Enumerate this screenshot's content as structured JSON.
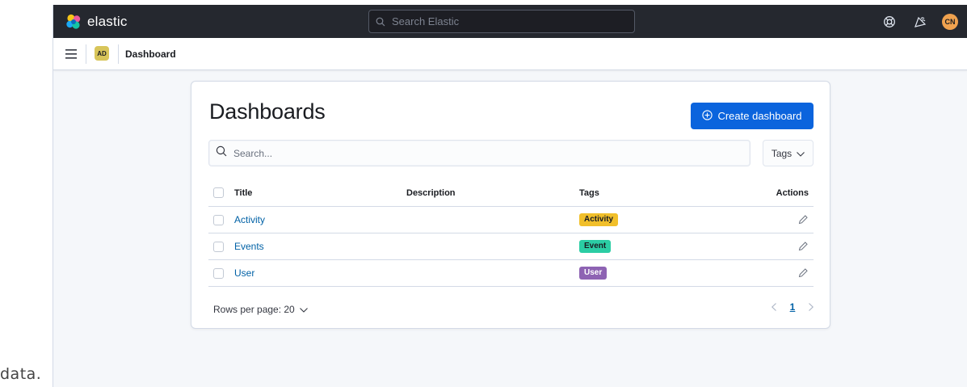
{
  "caption_fragment": "data.",
  "topbar": {
    "brand_name": "elastic",
    "search_placeholder": "Search Elastic",
    "icons": [
      "help-icon",
      "newsfeed-icon"
    ],
    "user_initials": "CN"
  },
  "header": {
    "space_initials": "AD",
    "breadcrumb": "Dashboard"
  },
  "main": {
    "title": "Dashboards",
    "create_button": "Create dashboard",
    "search_placeholder": "Search...",
    "tags_filter": "Tags",
    "columns": {
      "title": "Title",
      "description": "Description",
      "tags": "Tags",
      "actions": "Actions"
    },
    "rows": [
      {
        "title": "Activity",
        "description": "",
        "tag": "Activity",
        "tag_color": "#f1bf2a",
        "tag_text_color": "#1a1c21"
      },
      {
        "title": "Events",
        "description": "",
        "tag": "Event",
        "tag_color": "#2bcda4",
        "tag_text_color": "#1a1c21"
      },
      {
        "title": "User",
        "description": "",
        "tag": "User",
        "tag_color": "#8e63b3",
        "tag_text_color": "#ffffff"
      }
    ],
    "rows_per_page": "Rows per page: 20",
    "current_page": "1"
  },
  "colors": {
    "topbar_bg": "#25282f",
    "primary_button": "#0b64dd",
    "link": "#0061a6",
    "user_avatar": "#f0a24f",
    "space_avatar": "#d8c55a"
  }
}
